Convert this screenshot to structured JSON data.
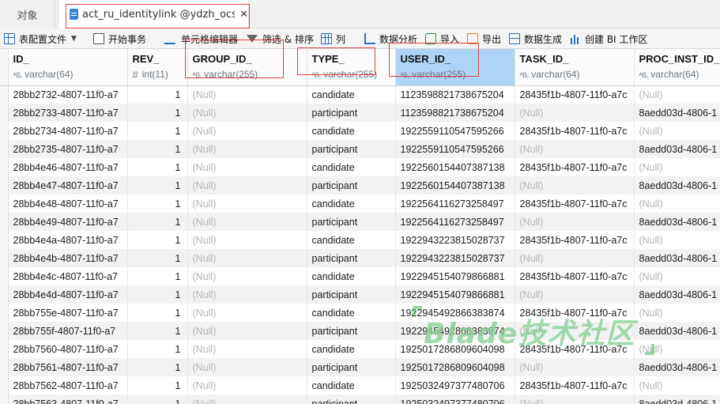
{
  "tabs": {
    "objects_label": "对象",
    "active_label": "act_ru_identitylink @ydzh_ocss_bas...",
    "close_glyph": "✕"
  },
  "toolbar": {
    "table_config": "表配置文件",
    "begin_tx": "开始事务",
    "cell_editor": "单元格编辑器",
    "filter_sort": "筛选 & 排序",
    "columns": "列",
    "data_analysis": "数据分析",
    "import": "导入",
    "export": "导出",
    "data_gen": "数据生成",
    "create_bi": "创建 BI 工作区"
  },
  "columns": [
    {
      "name": "ID_",
      "type": "varchar(64)",
      "kind": "text"
    },
    {
      "name": "REV_",
      "type": "int(11)",
      "kind": "number"
    },
    {
      "name": "GROUP_ID_",
      "type": "varchar(255)",
      "kind": "text"
    },
    {
      "name": "TYPE_",
      "type": "varchar(255)",
      "kind": "text"
    },
    {
      "name": "USER_ID_",
      "type": "varchar(255)",
      "kind": "text"
    },
    {
      "name": "TASK_ID_",
      "type": "varchar(64)",
      "kind": "text"
    },
    {
      "name": "PROC_INST_ID_",
      "type": "varchar(64)",
      "kind": "text"
    }
  ],
  "rows": [
    [
      "28bb2732-4807-11f0-a7",
      "1",
      "(Null)",
      "candidate",
      "1123598821738675204",
      "28435f1b-4807-11f0-a7c",
      "(Null)"
    ],
    [
      "28bb2733-4807-11f0-a7",
      "1",
      "(Null)",
      "participant",
      "1123598821738675204",
      "(Null)",
      "8aedd03d-4806-1"
    ],
    [
      "28bb2734-4807-11f0-a7",
      "1",
      "(Null)",
      "candidate",
      "1922559110547595266",
      "28435f1b-4807-11f0-a7c",
      "(Null)"
    ],
    [
      "28bb2735-4807-11f0-a7",
      "1",
      "(Null)",
      "participant",
      "1922559110547595266",
      "(Null)",
      "8aedd03d-4806-1"
    ],
    [
      "28bb4e46-4807-11f0-a7",
      "1",
      "(Null)",
      "candidate",
      "1922560154407387138",
      "28435f1b-4807-11f0-a7c",
      "(Null)"
    ],
    [
      "28bb4e47-4807-11f0-a7",
      "1",
      "(Null)",
      "participant",
      "1922560154407387138",
      "(Null)",
      "8aedd03d-4806-1"
    ],
    [
      "28bb4e48-4807-11f0-a7",
      "1",
      "(Null)",
      "candidate",
      "1922564116273258497",
      "28435f1b-4807-11f0-a7c",
      "(Null)"
    ],
    [
      "28bb4e49-4807-11f0-a7",
      "1",
      "(Null)",
      "participant",
      "1922564116273258497",
      "(Null)",
      "8aedd03d-4806-1"
    ],
    [
      "28bb4e4a-4807-11f0-a7",
      "1",
      "(Null)",
      "candidate",
      "1922943223815028737",
      "28435f1b-4807-11f0-a7c",
      "(Null)"
    ],
    [
      "28bb4e4b-4807-11f0-a7",
      "1",
      "(Null)",
      "participant",
      "1922943223815028737",
      "(Null)",
      "8aedd03d-4806-1"
    ],
    [
      "28bb4e4c-4807-11f0-a7",
      "1",
      "(Null)",
      "candidate",
      "1922945154079866881",
      "28435f1b-4807-11f0-a7c",
      "(Null)"
    ],
    [
      "28bb4e4d-4807-11f0-a7",
      "1",
      "(Null)",
      "participant",
      "1922945154079866881",
      "(Null)",
      "8aedd03d-4806-1"
    ],
    [
      "28bb755e-4807-11f0-a7",
      "1",
      "(Null)",
      "candidate",
      "1922945492866383874",
      "28435f1b-4807-11f0-a7c",
      "(Null)"
    ],
    [
      "28bb755f-4807-11f0-a7",
      "1",
      "(Null)",
      "participant",
      "1922945492866383874",
      "(Null)",
      "8aedd03d-4806-1"
    ],
    [
      "28bb7560-4807-11f0-a7",
      "1",
      "(Null)",
      "candidate",
      "1925017286809604098",
      "28435f1b-4807-11f0-a7c",
      "(Null)"
    ],
    [
      "28bb7561-4807-11f0-a7",
      "1",
      "(Null)",
      "participant",
      "1925017286809604098",
      "(Null)",
      "8aedd03d-4806-1"
    ],
    [
      "28bb7562-4807-11f0-a7",
      "1",
      "(Null)",
      "candidate",
      "1925032497377480706",
      "28435f1b-4807-11f0-a7c",
      "(Null)"
    ],
    [
      "28bb7563-4807-11f0-a7",
      "1",
      "(Null)",
      "participant",
      "1925032497377480706",
      "(Null)",
      "8aedd03d-4806-1"
    ]
  ],
  "watermark": {
    "text": "Blade技术社区"
  },
  "colors": {
    "annotation": "#e24444",
    "selected_header": "#aed4f5",
    "null_text": "#b4b4b4",
    "watermark": "#52bc68"
  }
}
